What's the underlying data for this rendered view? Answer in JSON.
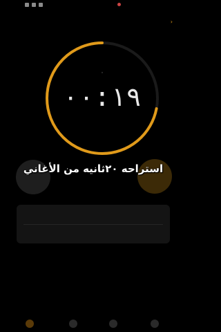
{
  "timer": {
    "time": "٠٠:١٩",
    "progress": 0.72
  },
  "caption": "استراحه ٢٠ثانيه من الأغاني",
  "colors": {
    "accent": "#e09a1a",
    "ring_track": "#1a1a1a",
    "background": "#000000"
  },
  "tabs": [
    {
      "icon": "alarm-icon"
    },
    {
      "icon": "clock-icon"
    },
    {
      "icon": "stopwatch-icon"
    },
    {
      "icon": "timer-icon"
    }
  ]
}
